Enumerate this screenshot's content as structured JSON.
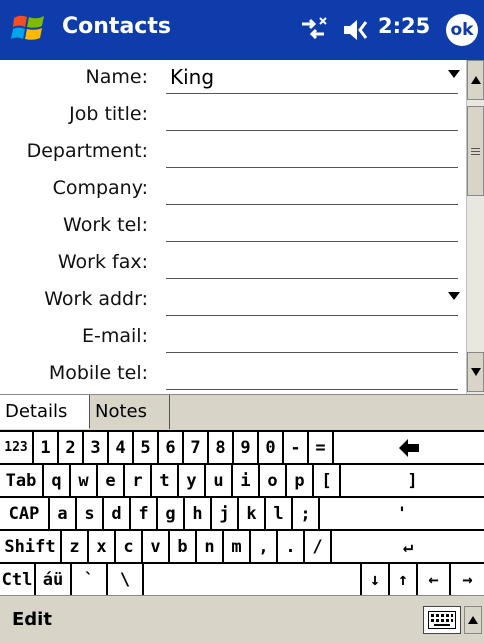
{
  "title_bar": {
    "title": "Contacts",
    "time": "2:25",
    "ok_label": "ok",
    "icons": [
      "windows-start-icon",
      "connectivity-icon",
      "volume-icon"
    ]
  },
  "form": {
    "fields": [
      {
        "label": "Name:",
        "value": "King",
        "dropdown": true
      },
      {
        "label": "Job title:",
        "value": "",
        "dropdown": false
      },
      {
        "label": "Department:",
        "value": "",
        "dropdown": false
      },
      {
        "label": "Company:",
        "value": "",
        "dropdown": false
      },
      {
        "label": "Work tel:",
        "value": "",
        "dropdown": false
      },
      {
        "label": "Work fax:",
        "value": "",
        "dropdown": false
      },
      {
        "label": "Work addr:",
        "value": "",
        "dropdown": true
      },
      {
        "label": "E-mail:",
        "value": "",
        "dropdown": false
      },
      {
        "label": "Mobile tel:",
        "value": "",
        "dropdown": false
      }
    ]
  },
  "tabs": [
    {
      "label": "Details",
      "active": true
    },
    {
      "label": "Notes",
      "active": false
    }
  ],
  "keyboard": {
    "rows": [
      [
        "123",
        "1",
        "2",
        "3",
        "4",
        "5",
        "6",
        "7",
        "8",
        "9",
        "0",
        "-",
        "=",
        "◆"
      ],
      [
        "Tab",
        "q",
        "w",
        "e",
        "r",
        "t",
        "y",
        "u",
        "i",
        "o",
        "p",
        "[",
        "]"
      ],
      [
        "CAP",
        "a",
        "s",
        "d",
        "f",
        "g",
        "h",
        "j",
        "k",
        "l",
        ";",
        "'"
      ],
      [
        "Shift",
        "z",
        "x",
        "c",
        "v",
        "b",
        "n",
        "m",
        ",",
        ".",
        "/",
        "↵"
      ],
      [
        "Ctl",
        "áü",
        "`",
        "\\",
        "",
        "↓",
        "↑",
        "←",
        "→"
      ]
    ]
  },
  "bottom_bar": {
    "menu_label": "Edit"
  },
  "colors": {
    "title_bar": "#0e3caa",
    "chrome": "#d8d4c8"
  }
}
